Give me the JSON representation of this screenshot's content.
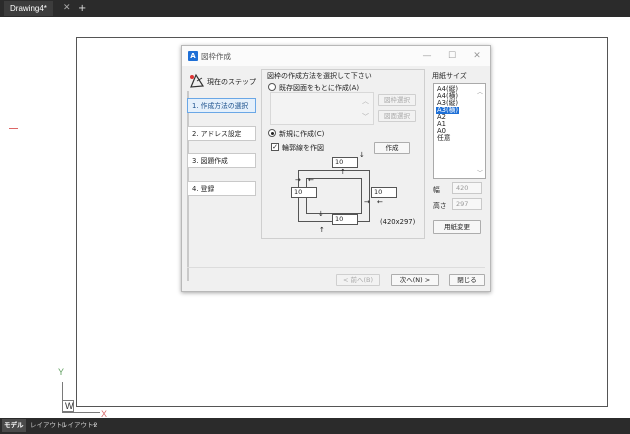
{
  "tabs": {
    "document": "Drawing4*",
    "close": "✕",
    "add": "+"
  },
  "layout_tabs": [
    "モデル",
    "レイアウト1",
    "レイアウト2",
    "+"
  ],
  "ucs": {
    "x": "X",
    "y": "Y",
    "w": "W"
  },
  "dialog": {
    "icon": "A",
    "title": "図枠作成",
    "controls": {
      "minimize": "—",
      "maximize": "☐",
      "close": "✕"
    },
    "current_step": "現在のステップ",
    "steps": [
      "1. 作成方法の選択",
      "2. アドレス設定",
      "3. 図題作成",
      "4. 登録"
    ],
    "active_step_index": 0,
    "heading": "図枠の作成方法を選択して下さい",
    "option_existing": "既存図面をもとに作成(A)",
    "btn_frame_select": "図枠選択",
    "btn_drawing_select": "図面選択",
    "option_new": "新規に作成(C)",
    "selected_option": "new",
    "checkbox_border": "輪郭線を作図",
    "checkbox_border_checked": true,
    "btn_create": "作成",
    "diagram": {
      "top": "10",
      "left": "10",
      "right": "10",
      "bottom": "10",
      "size": "(420x297)",
      "arrow_down": "↓",
      "arrow_up": "↑",
      "arrow_right": "→",
      "arrow_left": "←"
    },
    "paper_size_title": "用紙サイズ",
    "paper_sizes": [
      "A4(縦)",
      "A4(横)",
      "A3(縦)",
      "A3(横)",
      "A2",
      "A1",
      "A0",
      "任意"
    ],
    "selected_paper_index": 3,
    "width_label": "幅",
    "width_value": "420",
    "height_label": "高さ",
    "height_value": "297",
    "btn_change_paper": "用紙変更",
    "btn_back": "< 前へ(B)",
    "btn_next": "次へ(N) >",
    "btn_close": "閉じる"
  }
}
